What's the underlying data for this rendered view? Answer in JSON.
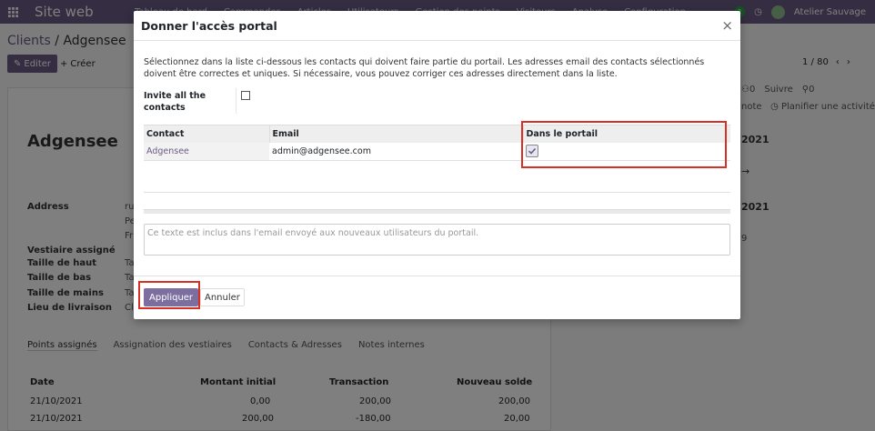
{
  "navbar": {
    "brand": "Site web",
    "menu": [
      "Tableau de bord",
      "Commandes",
      "Articles",
      "Utilisateurs",
      "Gestion des points",
      "Visiteurs",
      "Analyse",
      "Configuration"
    ],
    "badge": "2",
    "user": "Atelier Sauvage",
    "color": "#6b5a84"
  },
  "background": {
    "breadcrumb_parent": "Clients",
    "breadcrumb_sep": " / ",
    "breadcrumb_current": "Adgensee",
    "edit_label": "Editer",
    "create_label": "Créer",
    "pager": "1 / 80",
    "record_title": "Adgensee",
    "fields": [
      {
        "label": "Address",
        "value": "ru"
      },
      {
        "label": "Vestiaire assigné",
        "value": ""
      },
      {
        "label": "Taille de haut",
        "value": "Ta"
      },
      {
        "label": "Taille de bas",
        "value": "Ta"
      },
      {
        "label": "Taille de mains",
        "value": "Ta"
      },
      {
        "label": "Lieu de livraison",
        "value": "Cl"
      }
    ],
    "address_lines": [
      "ru",
      "Pe",
      "Fr"
    ],
    "tabs": [
      "Points assignés",
      "Assignation des vestiaires",
      "Contacts & Adresses",
      "Notes internes"
    ],
    "table_headers": [
      "Date",
      "Montant initial",
      "Transaction",
      "Nouveau solde"
    ],
    "table_rows": [
      [
        "21/10/2021",
        "0,00",
        "200,00",
        "200,00"
      ],
      [
        "21/10/2021",
        "200,00",
        "-180,00",
        "20,00"
      ]
    ],
    "chatter": {
      "followers": "0",
      "follow_label": "Suivre",
      "attachments": "0",
      "note_label": "note",
      "schedule_label": "Planifier une activité",
      "date1": "2021",
      "date2": "2021",
      "num": "9"
    }
  },
  "modal": {
    "title": "Donner l'accès portal",
    "intro": "Sélectionnez dans la liste ci-dessous les contacts qui doivent faire partie du portail. Les adresses email des contacts sélectionnés doivent être correctes et uniques. Si nécessaire, vous pouvez corriger ces adresses directement dans la liste.",
    "invite_label": "Invite all the contacts",
    "invite_checked": false,
    "columns": {
      "contact": "Contact",
      "email": "Email",
      "in_portal": "Dans le portail"
    },
    "rows": [
      {
        "contact": "Adgensee",
        "email": "admin@adgensee.com",
        "in_portal": true
      }
    ],
    "message_placeholder": "Ce texte est inclus dans l'email envoyé aux nouveaux utilisateurs du portail.",
    "apply_label": "Appliquer",
    "cancel_label": "Annuler"
  }
}
